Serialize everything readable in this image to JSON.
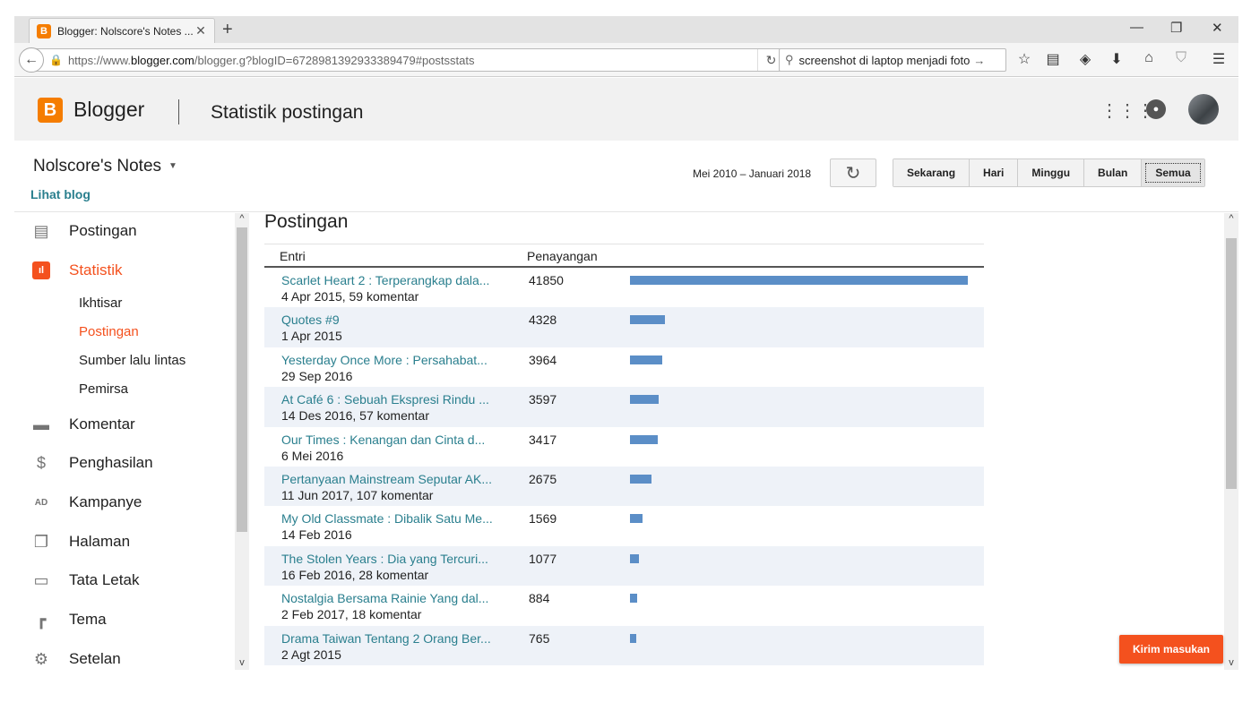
{
  "browser": {
    "tab_title": "Blogger: Nolscore's Notes ...",
    "url_prefix": "https://www.",
    "url_domain": "blogger.com",
    "url_path": "/blogger.g?blogID=6728981392933389479#postsstats",
    "search_value": "screenshot di laptop menjadi foto"
  },
  "header": {
    "brand": "Blogger",
    "page_title": "Statistik postingan"
  },
  "blog": {
    "name": "Nolscore's Notes",
    "view_link": "Lihat blog"
  },
  "range": {
    "label": "Mei 2010 – Januari 2018",
    "options": [
      "Sekarang",
      "Hari",
      "Minggu",
      "Bulan",
      "Semua"
    ],
    "selected": "Semua"
  },
  "sidebar": {
    "items": [
      {
        "label": "Postingan",
        "icon": "posts-icon"
      },
      {
        "label": "Statistik",
        "icon": "stats-icon",
        "active": true
      },
      {
        "label": "Komentar",
        "icon": "comment-icon"
      },
      {
        "label": "Penghasilan",
        "icon": "dollar-icon"
      },
      {
        "label": "Kampanye",
        "icon": "ad-icon"
      },
      {
        "label": "Halaman",
        "icon": "pages-icon"
      },
      {
        "label": "Tata Letak",
        "icon": "layout-icon"
      },
      {
        "label": "Tema",
        "icon": "paint-roller-icon"
      },
      {
        "label": "Setelan",
        "icon": "gear-icon"
      }
    ],
    "sub_items": [
      "Ikhtisar",
      "Postingan",
      "Sumber lalu lintas",
      "Pemirsa"
    ],
    "active_sub": "Postingan"
  },
  "main": {
    "title": "Postingan",
    "col_entry": "Entri",
    "col_views": "Penayangan",
    "max_views": 41850,
    "rows": [
      {
        "title": "Scarlet Heart 2 : Terperangkap dala...",
        "meta": "4 Apr 2015, 59 komentar",
        "views": 41850
      },
      {
        "title": "Quotes #9",
        "meta": "1 Apr 2015",
        "views": 4328
      },
      {
        "title": "Yesterday Once More : Persahabat...",
        "meta": "29 Sep 2016",
        "views": 3964
      },
      {
        "title": "At Café 6 : Sebuah Ekspresi Rindu ...",
        "meta": "14 Des 2016, 57 komentar",
        "views": 3597
      },
      {
        "title": "Our Times : Kenangan dan Cinta d...",
        "meta": "6 Mei 2016",
        "views": 3417
      },
      {
        "title": "Pertanyaan Mainstream Seputar AK...",
        "meta": "11 Jun 2017, 107 komentar",
        "views": 2675
      },
      {
        "title": "My Old Classmate : Dibalik Satu Me...",
        "meta": "14 Feb 2016",
        "views": 1569
      },
      {
        "title": "The Stolen Years : Dia yang Tercuri...",
        "meta": "16 Feb 2016, 28 komentar",
        "views": 1077
      },
      {
        "title": "Nostalgia Bersama Rainie Yang dal...",
        "meta": "2 Feb 2017, 18 komentar",
        "views": 884
      },
      {
        "title": "Drama Taiwan Tentang 2 Orang Ber...",
        "meta": "2 Agt 2015",
        "views": 765
      }
    ]
  },
  "feedback_label": "Kirim masukan",
  "colors": {
    "accent": "#f4511e",
    "brand": "#f57d00",
    "link": "#2a7f8e",
    "bar": "#5b8ec7"
  }
}
